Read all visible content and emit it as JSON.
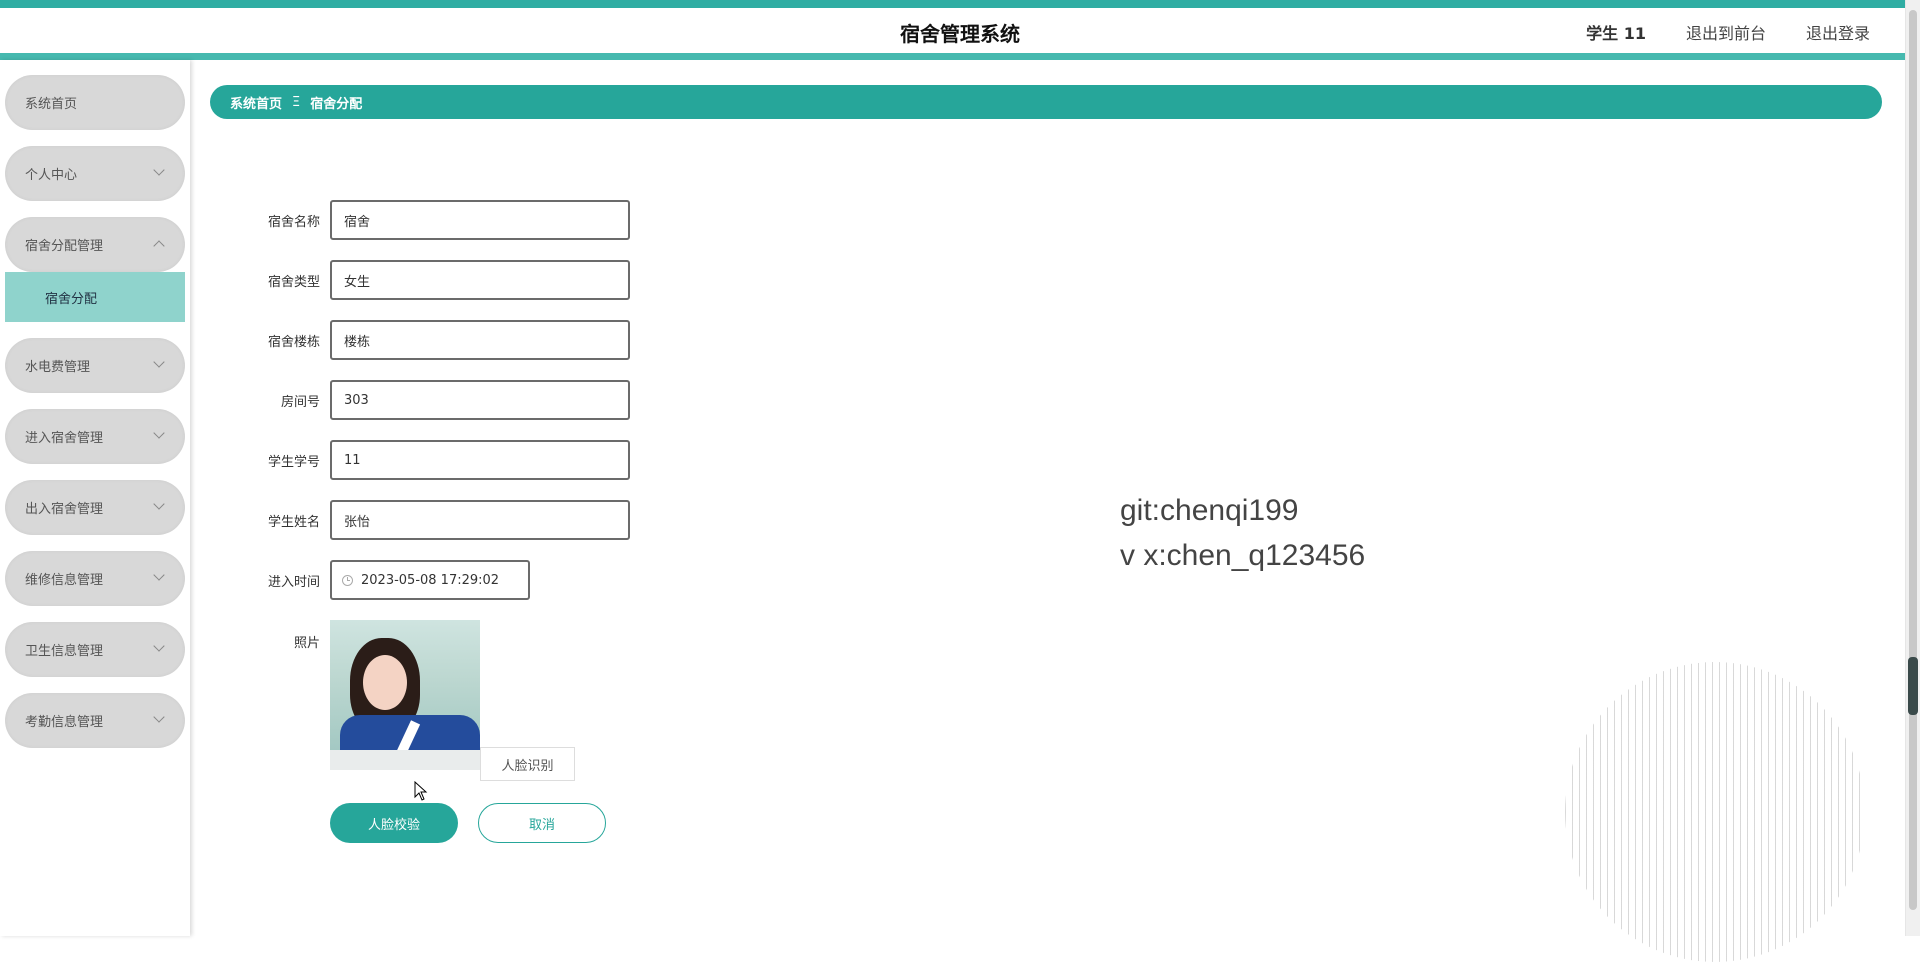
{
  "header": {
    "title": "宿舍管理系统",
    "user": "学生 11",
    "back_to_front": "退出到前台",
    "logout": "退出登录"
  },
  "sidebar": {
    "items": [
      {
        "label": "系统首页"
      },
      {
        "label": "个人中心"
      },
      {
        "label": "宿舍分配管理",
        "sub": "宿舍分配"
      },
      {
        "label": "水电费管理"
      },
      {
        "label": "进入宿舍管理"
      },
      {
        "label": "出入宿舍管理"
      },
      {
        "label": "维修信息管理"
      },
      {
        "label": "卫生信息管理"
      },
      {
        "label": "考勤信息管理"
      }
    ]
  },
  "breadcrumb": {
    "home": "系统首页",
    "separator": "Ξ",
    "current": "宿舍分配"
  },
  "form": {
    "dorm_name": {
      "label": "宿舍名称",
      "value": "宿舍"
    },
    "dorm_type": {
      "label": "宿舍类型",
      "value": "女生"
    },
    "building": {
      "label": "宿舍楼栋",
      "value": "楼栋"
    },
    "room_no": {
      "label": "房间号",
      "value": "303"
    },
    "student_id": {
      "label": "学生学号",
      "value": "11"
    },
    "student_name": {
      "label": "学生姓名",
      "value": "张怡"
    },
    "entry_time": {
      "label": "进入时间",
      "value": "2023-05-08 17:29:02"
    },
    "photo": {
      "label": "照片"
    },
    "face_recognition": "人脸识别",
    "verify_button": "人脸校验",
    "cancel_button": "取消"
  },
  "watermark": {
    "line1": "git:chenqi199",
    "line2": "v x:chen_q123456"
  },
  "colors": {
    "accent": "#26a69a",
    "submenu_active": "#8fd3cc",
    "menu_bg": "#d8d8d8"
  }
}
